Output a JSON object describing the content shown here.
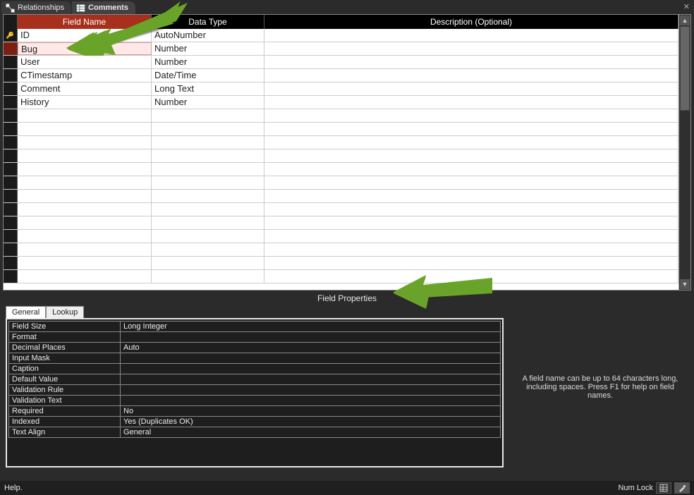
{
  "tabs": {
    "relationships": "Relationships",
    "comments": "Comments"
  },
  "grid": {
    "headers": {
      "field_name": "Field Name",
      "data_type": "Data Type",
      "description": "Description (Optional)"
    },
    "rows": [
      {
        "name": "ID",
        "type": "AutoNumber",
        "desc": "",
        "pk": true,
        "selected": false
      },
      {
        "name": "Bug",
        "type": "Number",
        "desc": "",
        "pk": false,
        "selected": true
      },
      {
        "name": "User",
        "type": "Number",
        "desc": "",
        "pk": false,
        "selected": false
      },
      {
        "name": "CTimestamp",
        "type": "Date/Time",
        "desc": "",
        "pk": false,
        "selected": false
      },
      {
        "name": "Comment",
        "type": "Long Text",
        "desc": "",
        "pk": false,
        "selected": false
      },
      {
        "name": "History",
        "type": "Number",
        "desc": "",
        "pk": false,
        "selected": false
      }
    ]
  },
  "section_title": "Field Properties",
  "prop_tabs": {
    "general": "General",
    "lookup": "Lookup"
  },
  "properties": [
    {
      "label": "Field Size",
      "value": "Long Integer"
    },
    {
      "label": "Format",
      "value": ""
    },
    {
      "label": "Decimal Places",
      "value": "Auto"
    },
    {
      "label": "Input Mask",
      "value": ""
    },
    {
      "label": "Caption",
      "value": ""
    },
    {
      "label": "Default Value",
      "value": ""
    },
    {
      "label": "Validation Rule",
      "value": ""
    },
    {
      "label": "Validation Text",
      "value": ""
    },
    {
      "label": "Required",
      "value": "No"
    },
    {
      "label": "Indexed",
      "value": "Yes (Duplicates OK)"
    },
    {
      "label": "Text Align",
      "value": "General"
    }
  ],
  "help_text": "A field name can be up to 64 characters long, including spaces. Press F1 for help on field names.",
  "status": {
    "left": "Help.",
    "numlock": "Num Lock"
  }
}
